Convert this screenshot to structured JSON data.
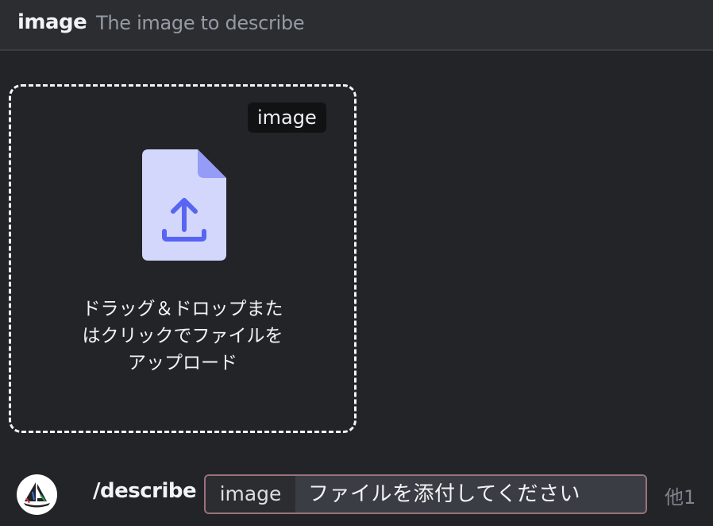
{
  "header": {
    "option_name": "image",
    "option_description": "The image to describe"
  },
  "upload": {
    "badge": "image",
    "instructions": [
      "ドラッグ＆ドロップまた",
      "はクリックでファイルを",
      "アップロード"
    ],
    "icon": "file-upload-icon"
  },
  "command_bar": {
    "avatar_icon": "midjourney-boat-icon",
    "command": "/describe",
    "param_name": "image",
    "param_value": "ファイルを添付してください",
    "more_options": "他1"
  },
  "colors": {
    "background": "#232428",
    "header_background": "#2b2d31",
    "file_icon": "#d4d7fc",
    "file_icon_accent": "#5865f2",
    "param_border": "#9a7378"
  }
}
